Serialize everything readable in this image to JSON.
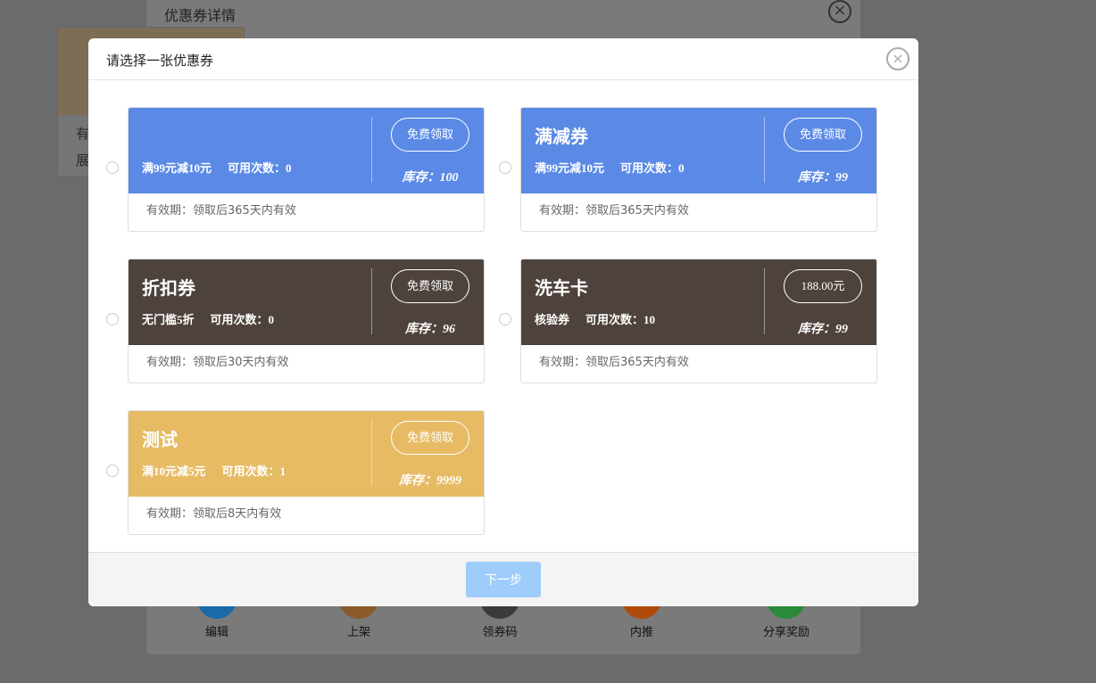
{
  "background": {
    "title": "优惠券详情",
    "card_lines": [
      "有",
      "展"
    ],
    "toolbar": [
      {
        "label": "编辑",
        "color": "#1a6aa8"
      },
      {
        "label": "上架",
        "color": "#8a5a2a"
      },
      {
        "label": "领券码",
        "color": "#3a3a3a"
      },
      {
        "label": "内推",
        "color": "#b04a0a"
      },
      {
        "label": "分享奖励",
        "color": "#2a8a3a"
      }
    ]
  },
  "modal": {
    "title": "请选择一张优惠券",
    "close_icon": "×",
    "next_label": "下一步"
  },
  "colors": {
    "blue": "#5b8ae6",
    "dark": "#4e433c",
    "gold": "#e6bb64"
  },
  "coupons": [
    {
      "name": "",
      "condition": "满99元减10元",
      "uses": "可用次数：0",
      "button": "免费领取",
      "stock": "库存：100",
      "validity": "有效期：领取后365天内有效",
      "color": "#5b8ae6"
    },
    {
      "name": "满减券",
      "condition": "满99元减10元",
      "uses": "可用次数：0",
      "button": "免费领取",
      "stock": "库存：99",
      "validity": "有效期：领取后365天内有效",
      "color": "#5b8ae6"
    },
    {
      "name": "折扣券",
      "condition": "无门槛5折",
      "uses": "可用次数：0",
      "button": "免费领取",
      "stock": "库存：96",
      "validity": "有效期：领取后30天内有效",
      "color": "#4e433c"
    },
    {
      "name": "洗车卡",
      "condition": "核验券",
      "uses": "可用次数：10",
      "button": "188.00元",
      "stock": "库存：99",
      "validity": "有效期：领取后365天内有效",
      "color": "#4e433c"
    },
    {
      "name": "测试",
      "condition": "满10元减5元",
      "uses": "可用次数：1",
      "button": "免费领取",
      "stock": "库存：9999",
      "validity": "有效期：领取后8天内有效",
      "color": "#e6bb64"
    }
  ]
}
